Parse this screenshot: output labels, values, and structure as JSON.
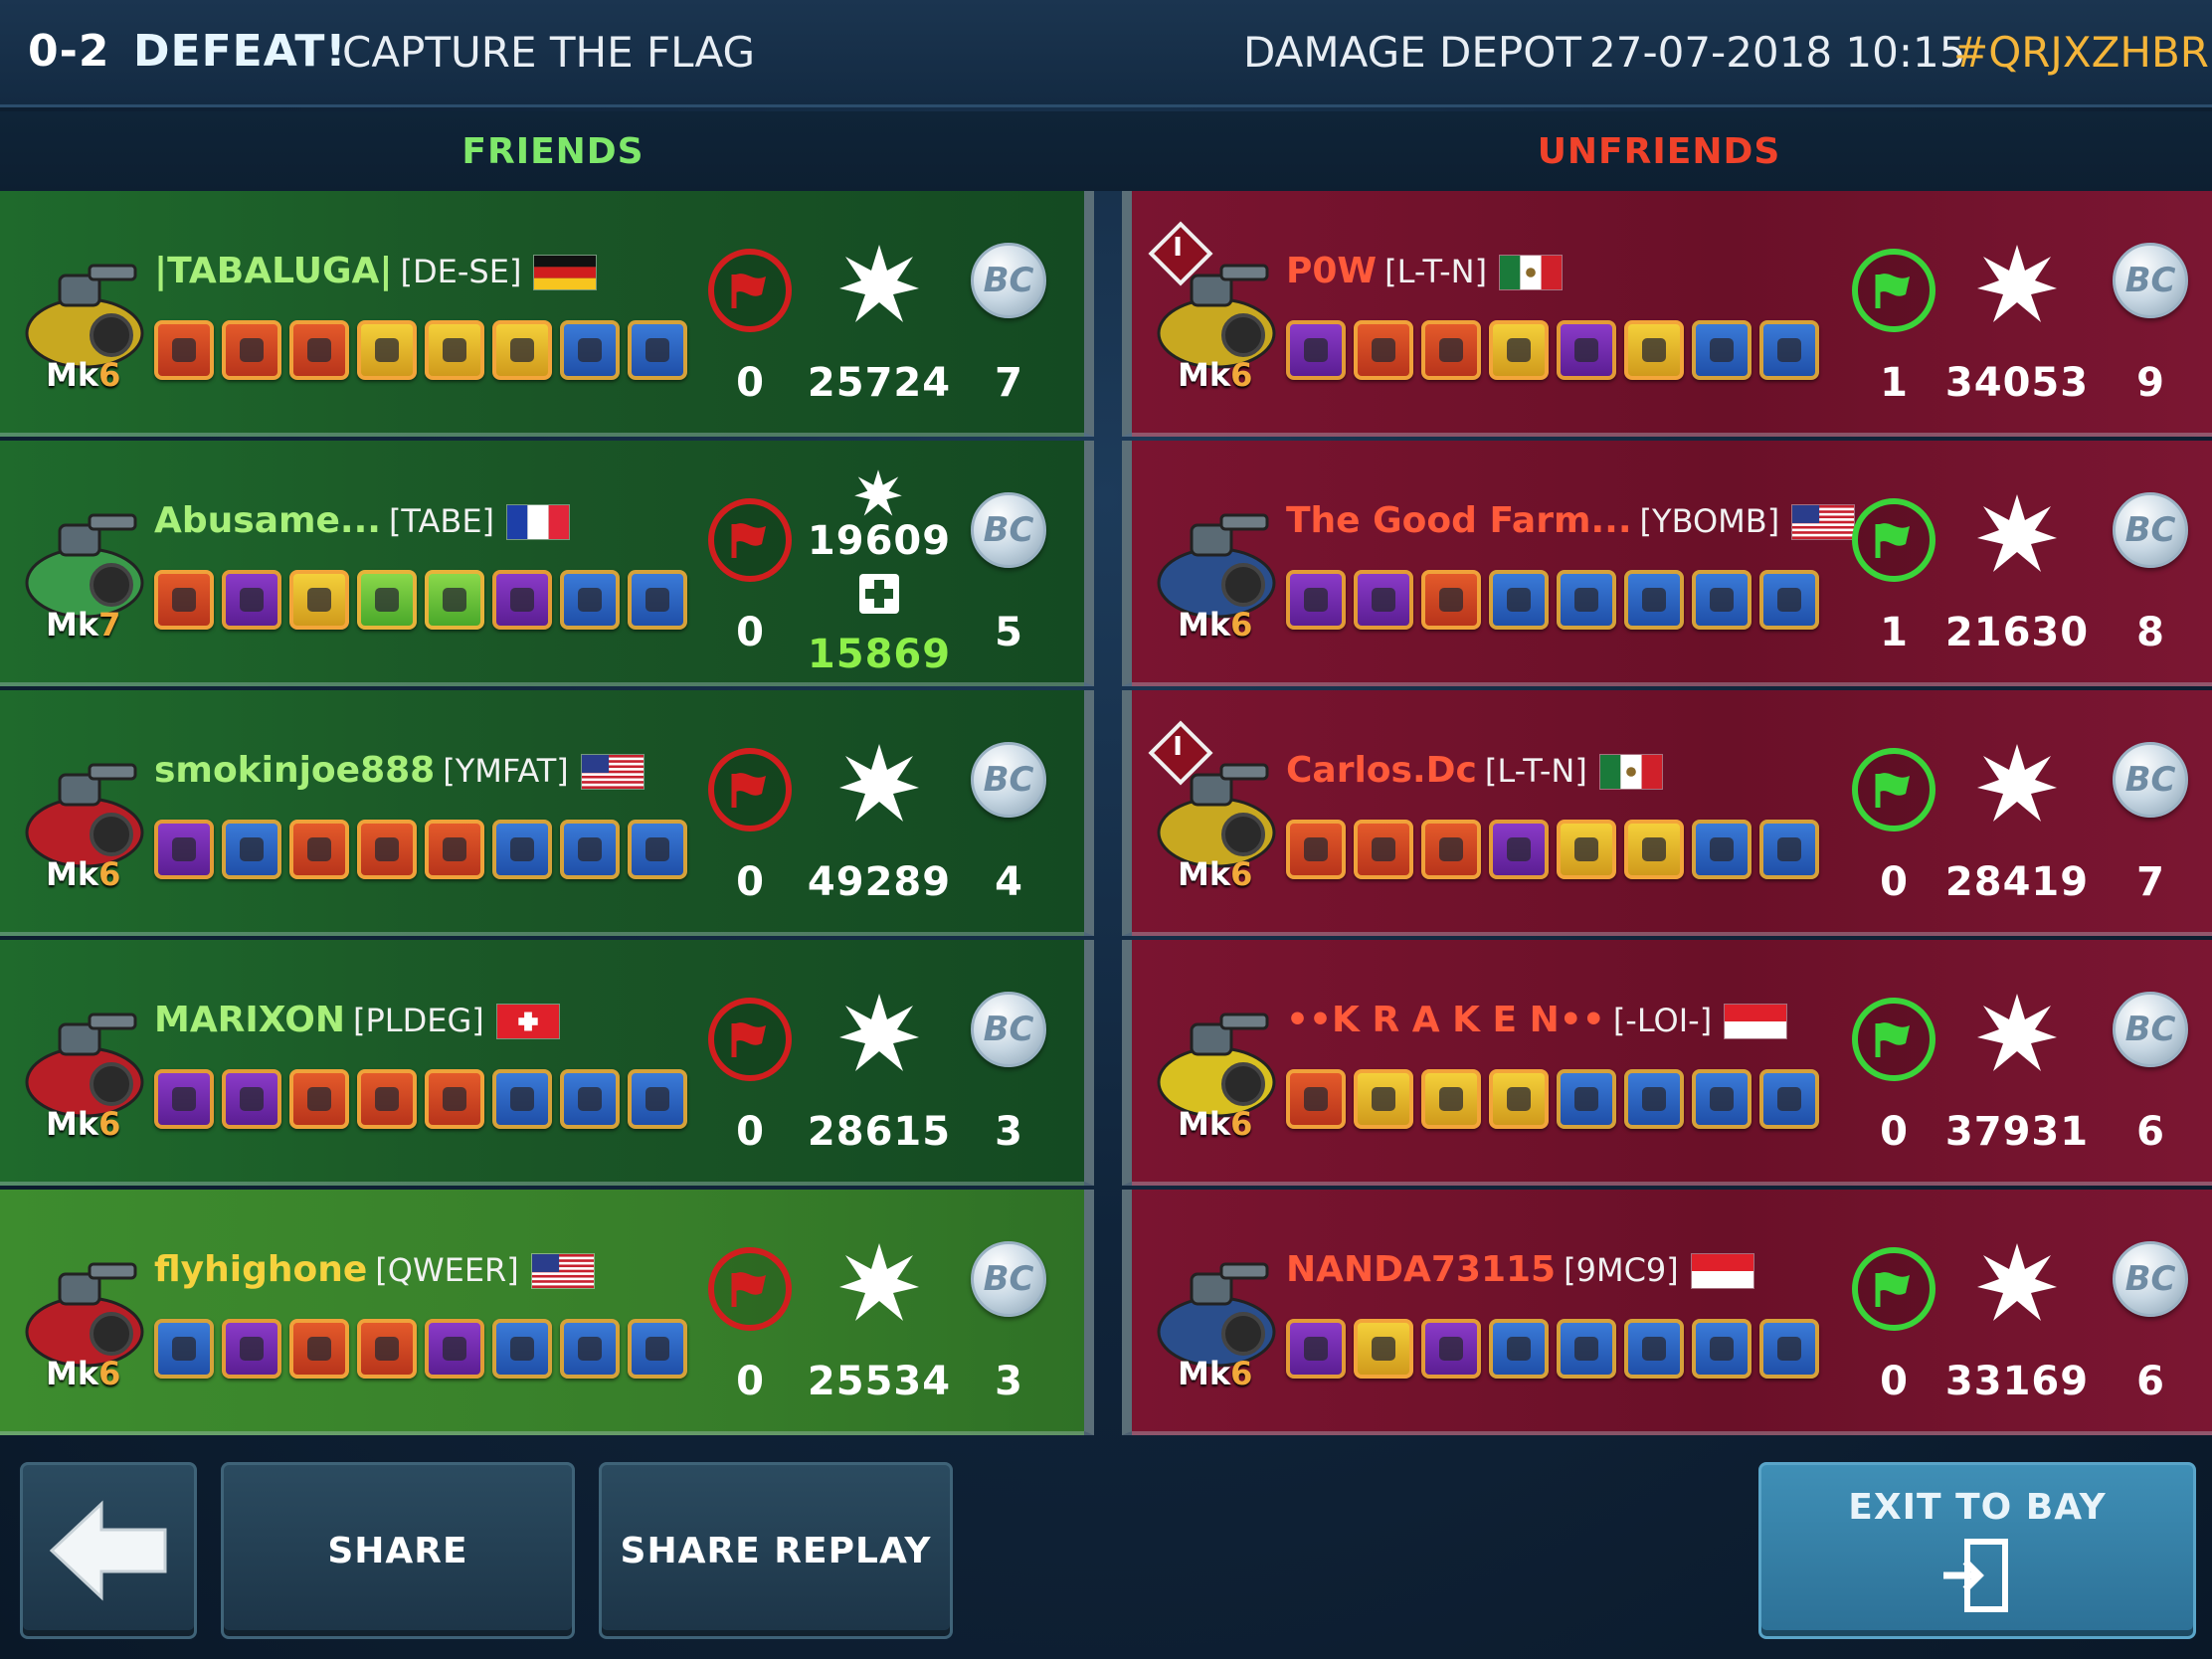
{
  "header": {
    "score": "0-2",
    "result": "DEFEAT!",
    "mode": "CAPTURE THE FLAG",
    "map": "DAMAGE DEPOT",
    "datetime": "27-07-2018 10:15",
    "match_code": "#QRJXZHBR"
  },
  "teams": {
    "friends_label": "FRIENDS",
    "unfriends_label": "UNFRIENDS"
  },
  "friends": [
    {
      "name": "|TABALUGA|",
      "clan": "[DE-SE]",
      "flag": "germany-flag",
      "mk_prefix": "Mk",
      "mk": "6",
      "captures": "0",
      "damage": "25724",
      "coins": "7"
    },
    {
      "name": "Abusame...",
      "clan": "[TABE]",
      "flag": "france-flag",
      "mk_prefix": "Mk",
      "mk": "7",
      "captures": "0",
      "damage": "19609",
      "healing": "15869",
      "coins": "5"
    },
    {
      "name": "smokinjoe888",
      "clan": "[YMFAT]",
      "flag": "usa-flag",
      "mk_prefix": "Mk",
      "mk": "6",
      "captures": "0",
      "damage": "49289",
      "coins": "4"
    },
    {
      "name": "MARIXON",
      "clan": "[PLDEG]",
      "flag": "switzerland-flag",
      "mk_prefix": "Mk",
      "mk": "6",
      "captures": "0",
      "damage": "28615",
      "coins": "3"
    },
    {
      "name": "flyhighone",
      "clan": "[QWEER]",
      "flag": "usa-flag",
      "mk_prefix": "Mk",
      "mk": "6",
      "captures": "0",
      "damage": "25534",
      "coins": "3"
    }
  ],
  "unfriends": [
    {
      "name": "P0W",
      "clan": "[L-T-N]",
      "flag": "mexico-flag",
      "mk_prefix": "Mk",
      "mk": "6",
      "captures": "1",
      "damage": "34053",
      "coins": "9",
      "badge": "I"
    },
    {
      "name": "The Good Farm...",
      "clan": "[YBOMB]",
      "flag": "usa-flag",
      "mk_prefix": "Mk",
      "mk": "6",
      "captures": "1",
      "damage": "21630",
      "coins": "8"
    },
    {
      "name": "Carlos.Dc",
      "clan": "[L-T-N]",
      "flag": "mexico-flag",
      "mk_prefix": "Mk",
      "mk": "6",
      "captures": "0",
      "damage": "28419",
      "coins": "7",
      "badge": "I"
    },
    {
      "name": "••K R A K E N••",
      "clan": "[-LOI-]",
      "flag": "indonesia-flag",
      "mk_prefix": "Mk",
      "mk": "6",
      "captures": "0",
      "damage": "37931",
      "coins": "6"
    },
    {
      "name": "NANDA73115",
      "clan": "[9MC9]",
      "flag": "indonesia-flag",
      "mk_prefix": "Mk",
      "mk": "6",
      "captures": "0",
      "damage": "33169",
      "coins": "6"
    }
  ],
  "coin_glyph": "BC",
  "buttons": {
    "share": "SHARE",
    "share_replay": "SHARE REPLAY",
    "exit": "EXIT TO BAY"
  },
  "colors": {
    "friends_accent": "#7fe86a",
    "unfriends_accent": "#f0422a",
    "match_code": "#f4b53a"
  }
}
